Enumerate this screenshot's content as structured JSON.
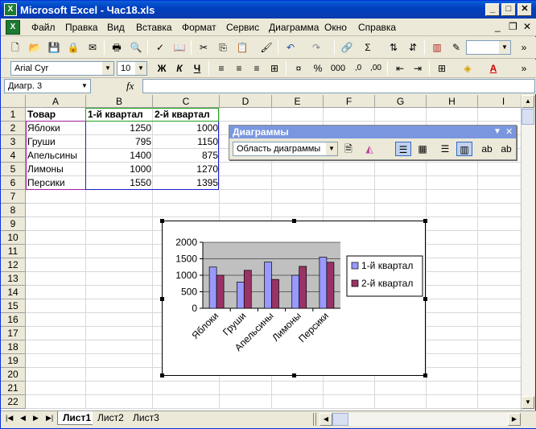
{
  "window": {
    "title": "Microsoft Excel - Час18.xls"
  },
  "menu": [
    "Файл",
    "Правка",
    "Вид",
    "Вставка",
    "Формат",
    "Сервис",
    "Диаграмма",
    "Окно",
    "Справка"
  ],
  "format_toolbar": {
    "font": "Arial Cyr",
    "size": "10",
    "bold": "Ж",
    "italic": "К",
    "underline": "Ч",
    "percent": "%",
    "thousands": "000"
  },
  "formula_bar": {
    "name_box": "Диагр. 3",
    "fx": "fx"
  },
  "columns": [
    "A",
    "B",
    "C",
    "D",
    "E",
    "F",
    "G",
    "H",
    "I"
  ],
  "rows": [
    "1",
    "2",
    "3",
    "4",
    "5",
    "6",
    "7",
    "8",
    "9",
    "10",
    "11",
    "12",
    "13",
    "14",
    "15",
    "16",
    "17",
    "18",
    "19",
    "20",
    "21",
    "22"
  ],
  "table": {
    "headers": [
      "Товар",
      "1-й квартал",
      "2-й квартал"
    ],
    "rows": [
      [
        "Яблоки",
        "1250",
        "1000"
      ],
      [
        "Груши",
        "795",
        "1150"
      ],
      [
        "Апельсины",
        "1400",
        "875"
      ],
      [
        "Лимоны",
        "1000",
        "1270"
      ],
      [
        "Персики",
        "1550",
        "1395"
      ]
    ]
  },
  "chart_toolbar": {
    "title": "Диаграммы",
    "element": "Область диаграммы"
  },
  "chart_data": {
    "type": "bar",
    "categories": [
      "Яблоки",
      "Груши",
      "Апельсины",
      "Лимоны",
      "Персики"
    ],
    "series": [
      {
        "name": "1-й квартал",
        "values": [
          1250,
          795,
          1400,
          1000,
          1550
        ],
        "color": "#9999ff"
      },
      {
        "name": "2-й квартал",
        "values": [
          1000,
          1150,
          875,
          1270,
          1395
        ],
        "color": "#993366"
      }
    ],
    "ylim": [
      0,
      2000
    ],
    "yticks": [
      "0",
      "500",
      "1000",
      "1500",
      "2000"
    ],
    "plot_bg": "#c0c0c0",
    "legend": "right"
  },
  "sheets": [
    "Лист1",
    "Лист2",
    "Лист3"
  ]
}
